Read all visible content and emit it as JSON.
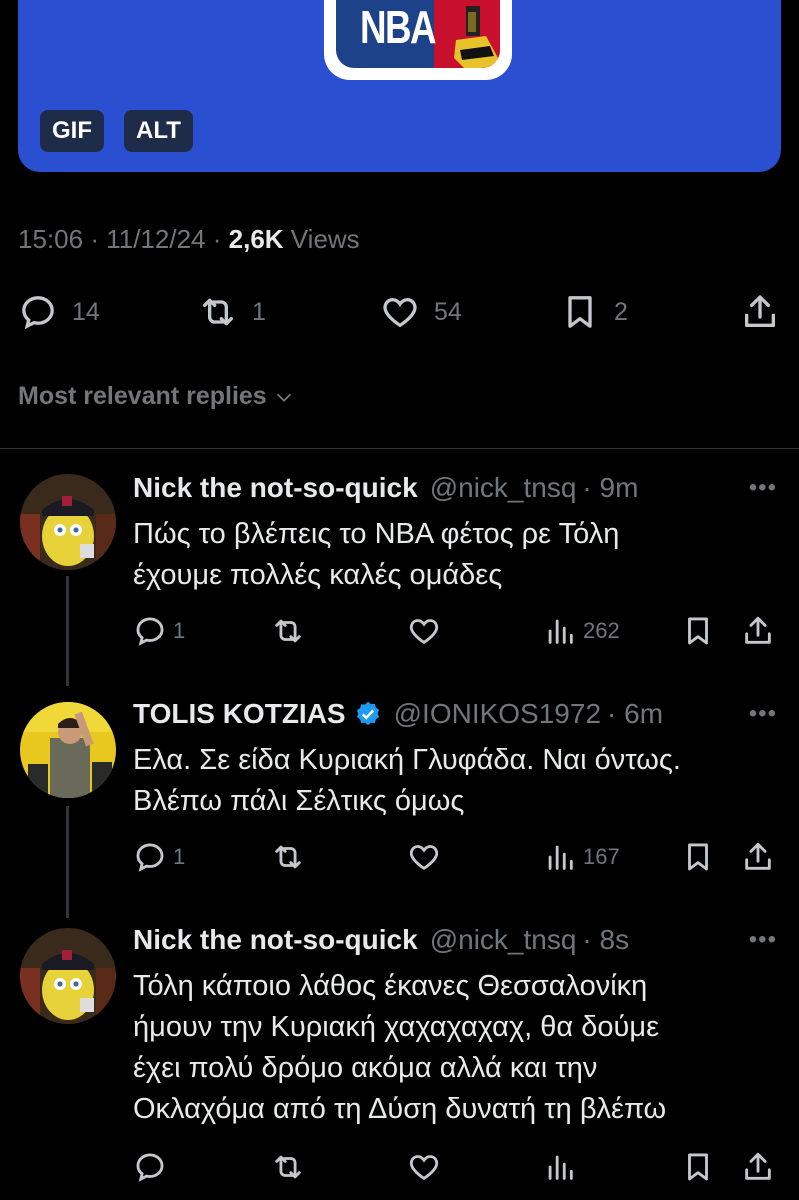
{
  "media": {
    "logo_text": "NBA",
    "badges": [
      "GIF",
      "ALT"
    ]
  },
  "meta": {
    "time": "15:06",
    "sep1": "·",
    "date": "11/12/24",
    "sep2": "·",
    "views_count": "2,6K",
    "views_label": "Views"
  },
  "actions": {
    "replies": "14",
    "reposts": "1",
    "likes": "54",
    "bookmarks": "2"
  },
  "replies_filter": {
    "label": "Most relevant replies"
  },
  "replies": [
    {
      "name": "Nick the not-so-quick",
      "handle": "@nick_tnsq",
      "time": "· 9m",
      "text_line1": "Πώς το βλέπεις το ΝΒΑ φέτος ρε Τόλη",
      "text_line2": "έχουμε πολλές καλές ομάδες",
      "replies": "1",
      "views": "262"
    },
    {
      "name": "TOLIS KOTZIAS",
      "handle": "@IONIKOS1972",
      "time": "· 6m",
      "text_line1": "Ελα. Σε είδα Κυριακή Γλυφάδα. Ναι όντως.",
      "text_line2": "Βλέπω πάλι Σέλτικς όμως",
      "replies": "1",
      "views": "167"
    },
    {
      "name": "Nick the not-so-quick",
      "handle": "@nick_tnsq",
      "time": "· 8s",
      "text_line1": "Τόλη κάποιο λάθος έκανες Θεσσαλονίκη",
      "text_line2": "ήμουν την Κυριακή χαχαχαχαχ, θα δούμε",
      "text_line3": "έχει πολύ δρόμο ακόμα αλλά και την",
      "text_line4": "Οκλαχόμα από τη Δύση δυνατή τη βλέπω"
    }
  ],
  "colors": {
    "background": "#000000",
    "muted": "#71767b",
    "text": "#e7e9ea",
    "media_bg": "#2a4fd0",
    "verified": "#1d9bf0"
  },
  "icons": [
    "reply-icon",
    "repost-icon",
    "like-icon",
    "bookmark-icon",
    "share-icon",
    "views-icon",
    "more-icon",
    "verified-icon",
    "chevron-down-icon"
  ]
}
